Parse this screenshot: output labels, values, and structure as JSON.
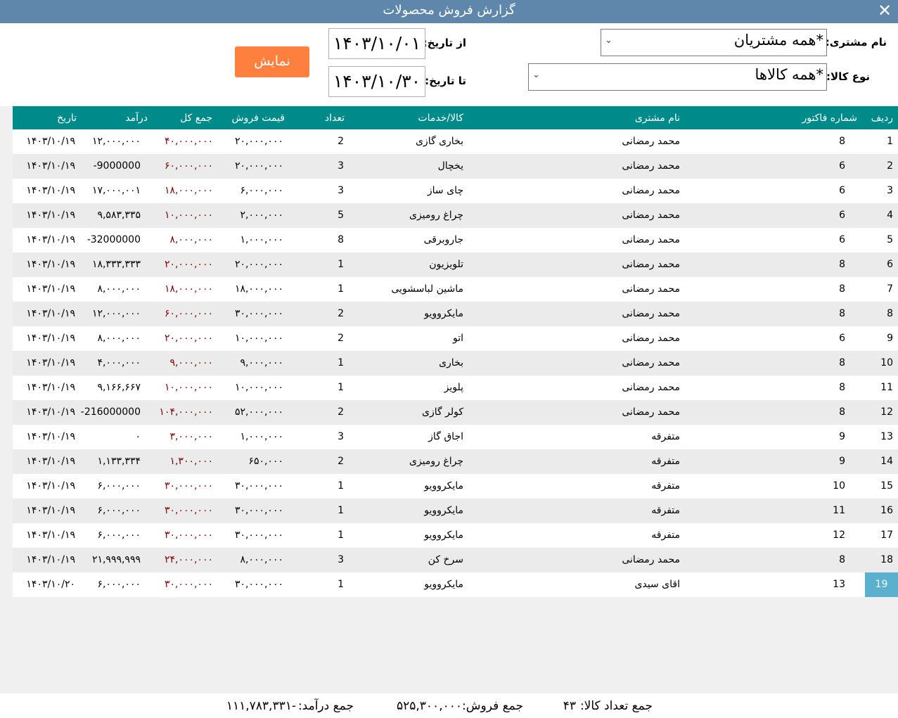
{
  "window": {
    "title": "گزارش فروش محصولات",
    "close_glyph": "✕"
  },
  "filters": {
    "customer_label": "نام مشتری:",
    "customer_value": "*همه مشتریان",
    "product_label": "نوع کالا:",
    "product_value": "*همه کالاها",
    "from_label": "از تاریخ:",
    "from_value": "۱۴۰۳/۱۰/۰۱",
    "to_label": "تا تاریخ:",
    "to_value": "۱۴۰۳/۱۰/۳۰",
    "show_button": "نمایش"
  },
  "table": {
    "headers": {
      "row": "ردیف",
      "invoice": "شماره فاکتور",
      "customer": "نام مشتری",
      "product": "کالا/خدمات",
      "qty": "تعداد",
      "price": "قیمت فروش",
      "total": "جمع کل",
      "income": "درآمد",
      "date": "تاریخ"
    },
    "rows": [
      {
        "row": "1",
        "invoice": "8",
        "customer": "محمد رمضانی",
        "product": "بخاری گازی",
        "qty": "2",
        "price": "۲۰,۰۰۰,۰۰۰",
        "total": "۴۰,۰۰۰,۰۰۰",
        "income": "۱۲,۰۰۰,۰۰۰",
        "date": "۱۴۰۳/۱۰/۱۹"
      },
      {
        "row": "2",
        "invoice": "6",
        "customer": "محمد رمضانی",
        "product": "یخچال",
        "qty": "3",
        "price": "۲۰,۰۰۰,۰۰۰",
        "total": "۶۰,۰۰۰,۰۰۰",
        "income": "-9000000",
        "date": "۱۴۰۳/۱۰/۱۹"
      },
      {
        "row": "3",
        "invoice": "6",
        "customer": "محمد رمضانی",
        "product": "چای ساز",
        "qty": "3",
        "price": "۶,۰۰۰,۰۰۰",
        "total": "۱۸,۰۰۰,۰۰۰",
        "income": "۱۷,۰۰۰,۰۰۱",
        "date": "۱۴۰۳/۱۰/۱۹"
      },
      {
        "row": "4",
        "invoice": "6",
        "customer": "محمد رمضانی",
        "product": "چراغ رومیزی",
        "qty": "5",
        "price": "۲,۰۰۰,۰۰۰",
        "total": "۱۰,۰۰۰,۰۰۰",
        "income": "۹,۵۸۳,۳۳۵",
        "date": "۱۴۰۳/۱۰/۱۹"
      },
      {
        "row": "5",
        "invoice": "6",
        "customer": "محمد رمضانی",
        "product": "جاروبرقی",
        "qty": "8",
        "price": "۱,۰۰۰,۰۰۰",
        "total": "۸,۰۰۰,۰۰۰",
        "income": "-32000000",
        "date": "۱۴۰۳/۱۰/۱۹"
      },
      {
        "row": "6",
        "invoice": "8",
        "customer": "محمد رمضانی",
        "product": "تلویزیون",
        "qty": "1",
        "price": "۲۰,۰۰۰,۰۰۰",
        "total": "۲۰,۰۰۰,۰۰۰",
        "income": "۱۸,۳۳۳,۳۳۳",
        "date": "۱۴۰۳/۱۰/۱۹"
      },
      {
        "row": "7",
        "invoice": "8",
        "customer": "محمد رمضانی",
        "product": "ماشین لباسشویی",
        "qty": "1",
        "price": "۱۸,۰۰۰,۰۰۰",
        "total": "۱۸,۰۰۰,۰۰۰",
        "income": "۸,۰۰۰,۰۰۰",
        "date": "۱۴۰۳/۱۰/۱۹"
      },
      {
        "row": "8",
        "invoice": "8",
        "customer": "محمد رمضانی",
        "product": "مایکروویو",
        "qty": "2",
        "price": "۳۰,۰۰۰,۰۰۰",
        "total": "۶۰,۰۰۰,۰۰۰",
        "income": "۱۲,۰۰۰,۰۰۰",
        "date": "۱۴۰۳/۱۰/۱۹"
      },
      {
        "row": "9",
        "invoice": "6",
        "customer": "محمد رمضانی",
        "product": "اتو",
        "qty": "2",
        "price": "۱۰,۰۰۰,۰۰۰",
        "total": "۲۰,۰۰۰,۰۰۰",
        "income": "۸,۰۰۰,۰۰۰",
        "date": "۱۴۰۳/۱۰/۱۹"
      },
      {
        "row": "10",
        "invoice": "8",
        "customer": "محمد رمضانی",
        "product": "بخاری",
        "qty": "1",
        "price": "۹,۰۰۰,۰۰۰",
        "total": "۹,۰۰۰,۰۰۰",
        "income": "۴,۰۰۰,۰۰۰",
        "date": "۱۴۰۳/۱۰/۱۹"
      },
      {
        "row": "11",
        "invoice": "8",
        "customer": "محمد رمضانی",
        "product": "پلویز",
        "qty": "1",
        "price": "۱۰,۰۰۰,۰۰۰",
        "total": "۱۰,۰۰۰,۰۰۰",
        "income": "۹,۱۶۶,۶۶۷",
        "date": "۱۴۰۳/۱۰/۱۹"
      },
      {
        "row": "12",
        "invoice": "8",
        "customer": "محمد رمضانی",
        "product": "کولر گازی",
        "qty": "2",
        "price": "۵۲,۰۰۰,۰۰۰",
        "total": "۱۰۴,۰۰۰,۰۰۰",
        "income": "-216000000",
        "date": "۱۴۰۳/۱۰/۱۹"
      },
      {
        "row": "13",
        "invoice": "9",
        "customer": "متفرقه",
        "product": "اجاق گاز",
        "qty": "3",
        "price": "۱,۰۰۰,۰۰۰",
        "total": "۳,۰۰۰,۰۰۰",
        "income": "۰",
        "date": "۱۴۰۳/۱۰/۱۹"
      },
      {
        "row": "14",
        "invoice": "9",
        "customer": "متفرقه",
        "product": "چراغ رومیزی",
        "qty": "2",
        "price": "۶۵۰,۰۰۰",
        "total": "۱,۳۰۰,۰۰۰",
        "income": "۱,۱۳۳,۳۳۴",
        "date": "۱۴۰۳/۱۰/۱۹"
      },
      {
        "row": "15",
        "invoice": "10",
        "customer": "متفرقه",
        "product": "مایکروویو",
        "qty": "1",
        "price": "۳۰,۰۰۰,۰۰۰",
        "total": "۳۰,۰۰۰,۰۰۰",
        "income": "۶,۰۰۰,۰۰۰",
        "date": "۱۴۰۳/۱۰/۱۹"
      },
      {
        "row": "16",
        "invoice": "11",
        "customer": "متفرقه",
        "product": "مایکروویو",
        "qty": "1",
        "price": "۳۰,۰۰۰,۰۰۰",
        "total": "۳۰,۰۰۰,۰۰۰",
        "income": "۶,۰۰۰,۰۰۰",
        "date": "۱۴۰۳/۱۰/۱۹"
      },
      {
        "row": "17",
        "invoice": "12",
        "customer": "متفرقه",
        "product": "مایکروویو",
        "qty": "1",
        "price": "۳۰,۰۰۰,۰۰۰",
        "total": "۳۰,۰۰۰,۰۰۰",
        "income": "۶,۰۰۰,۰۰۰",
        "date": "۱۴۰۳/۱۰/۱۹"
      },
      {
        "row": "18",
        "invoice": "8",
        "customer": "محمد رمضانی",
        "product": "سرخ کن",
        "qty": "3",
        "price": "۸,۰۰۰,۰۰۰",
        "total": "۲۴,۰۰۰,۰۰۰",
        "income": "۲۱,۹۹۹,۹۹۹",
        "date": "۱۴۰۳/۱۰/۱۹"
      },
      {
        "row": "19",
        "invoice": "13",
        "customer": "اقای سیدی",
        "product": "مایکروویو",
        "qty": "1",
        "price": "۳۰,۰۰۰,۰۰۰",
        "total": "۳۰,۰۰۰,۰۰۰",
        "income": "۶,۰۰۰,۰۰۰",
        "date": "۱۴۰۳/۱۰/۲۰"
      }
    ]
  },
  "footer": {
    "count_label": "جمع تعداد کالا:",
    "count_value": "۴۳",
    "sales_label": "جمع فروش:",
    "sales_value": "۵۲۵,۳۰۰,۰۰۰",
    "income_label": "جمع درآمد:",
    "income_value": "-۱۱۱,۷۸۳,۳۳۱"
  },
  "colors": {
    "header_bg": "#008b8b",
    "titlebar_bg": "#5f87ab",
    "button_bg": "#ff7f3f",
    "total_text": "#8b0000",
    "selected_cell": "#5bb0cf"
  }
}
